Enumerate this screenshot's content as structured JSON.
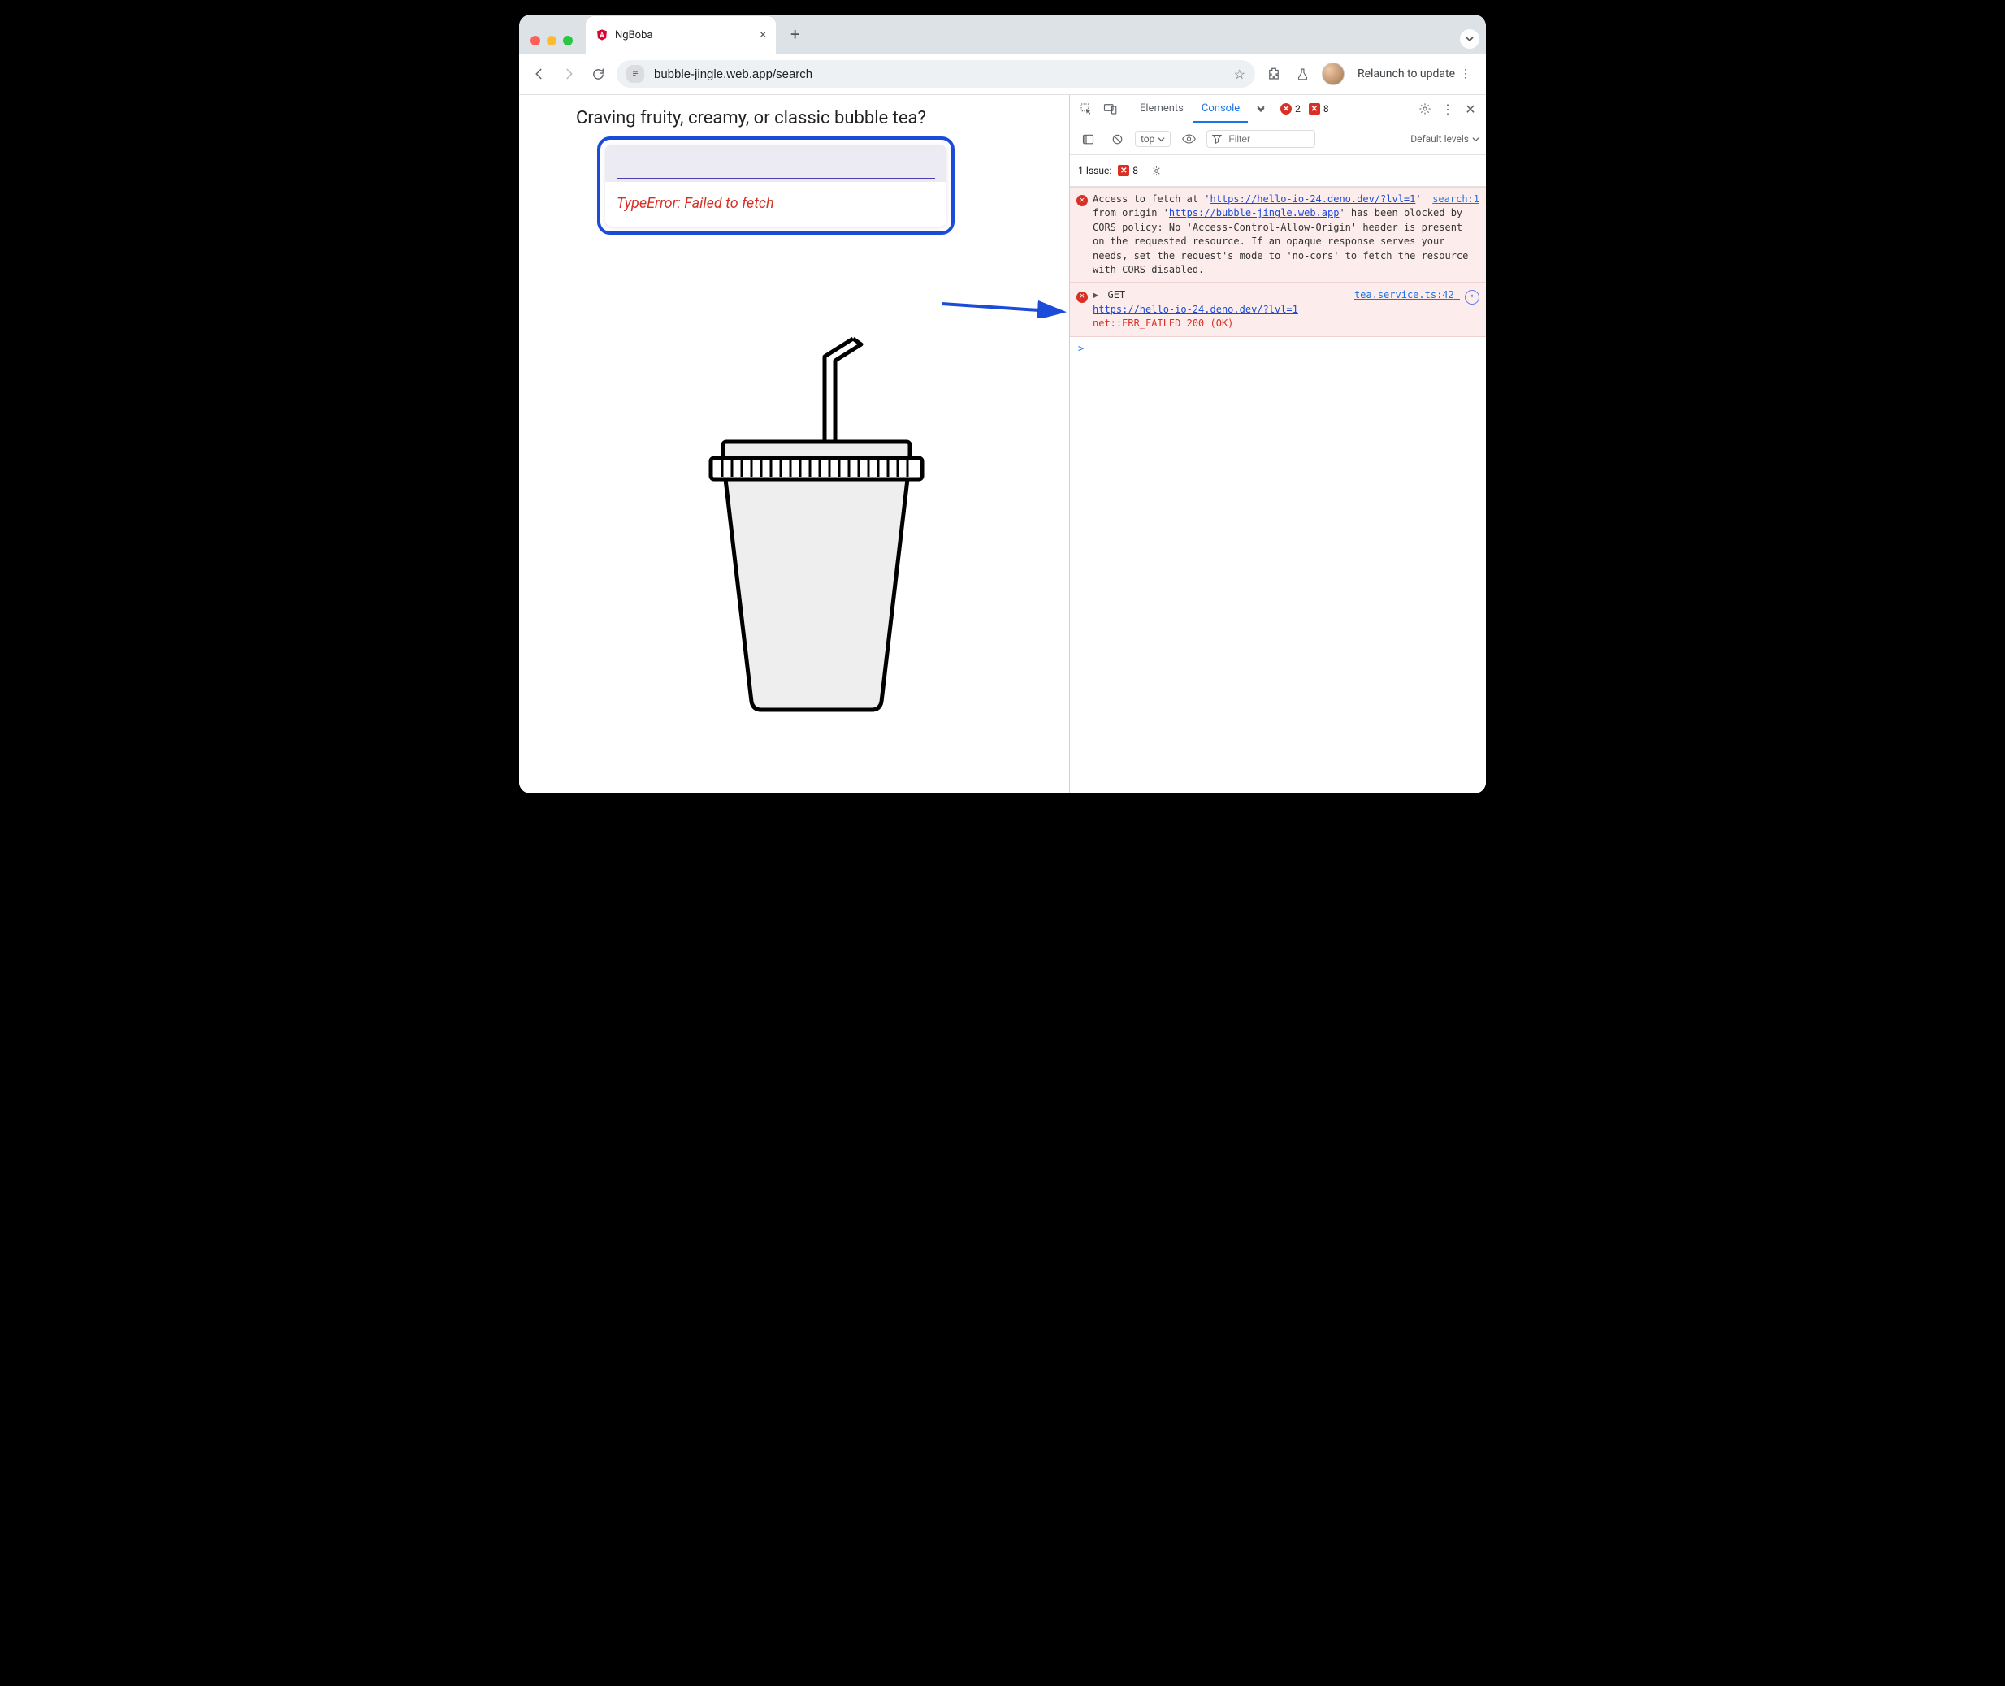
{
  "browser": {
    "tab_title": "NgBoba",
    "url_display": "bubble-jingle.web.app/search",
    "relaunch_label": "Relaunch to update"
  },
  "page": {
    "heading": "Craving fruity, creamy, or classic bubble tea?",
    "search_value": "",
    "error_message": "TypeError: Failed to fetch"
  },
  "devtools": {
    "tabs": {
      "elements": "Elements",
      "console": "Console"
    },
    "counts": {
      "errors": 2,
      "warnings": 8
    },
    "filter": {
      "execution_context": "top",
      "filter_placeholder": "Filter",
      "levels_label": "Default levels"
    },
    "issues": {
      "label": "1 Issue:",
      "warn_count": 8
    },
    "log": [
      {
        "type": "cors",
        "source_link": "search:1",
        "text_pre": "Access to fetch at '",
        "url1": "https://hello-io-24.deno.dev/?lvl=1",
        "text_mid": "' from origin '",
        "url2": "https://bubble-jingle.web.app",
        "text_post": "' has been blocked by CORS policy: No 'Access-Control-Allow-Origin' header is present on the requested resource. If an opaque response serves your needs, set the request's mode to 'no-cors' to fetch the resource with CORS disabled."
      },
      {
        "type": "neterr",
        "method": "GET",
        "source_link": "tea.service.ts:42",
        "url": "https://hello-io-24.deno.dev/?lvl=1",
        "status": "net::ERR_FAILED 200 (OK)"
      }
    ],
    "prompt": ">"
  }
}
